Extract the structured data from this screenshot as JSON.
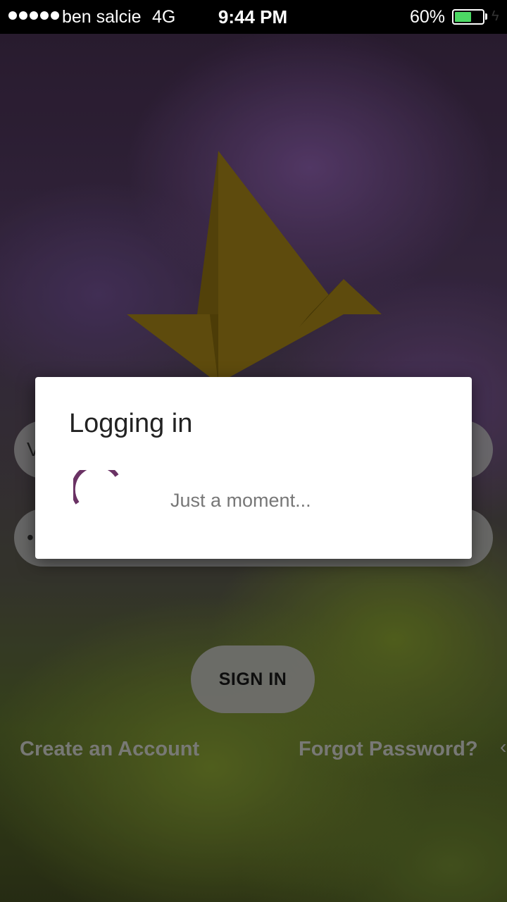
{
  "status_bar": {
    "carrier": "ben salcie",
    "network": "4G",
    "time": "9:44 PM",
    "battery_percent": "60%",
    "battery_level": 0.6,
    "signal_dots": 5
  },
  "login_form": {
    "email_value": "V",
    "password_value": "•",
    "sign_in_label": "SIGN IN",
    "create_account_label": "Create an Account",
    "forgot_password_label": "Forgot Password?"
  },
  "dialog": {
    "title": "Logging in",
    "message": "Just a moment..."
  },
  "colors": {
    "spinner": "#6a3264",
    "logo_gold": "#6b560f",
    "battery_green": "#4cd964"
  },
  "icons": {
    "logo": "origami-bird-logo-icon",
    "spinner": "loading-spinner-icon",
    "battery": "battery-icon",
    "bolt": "charging-bolt-icon"
  }
}
